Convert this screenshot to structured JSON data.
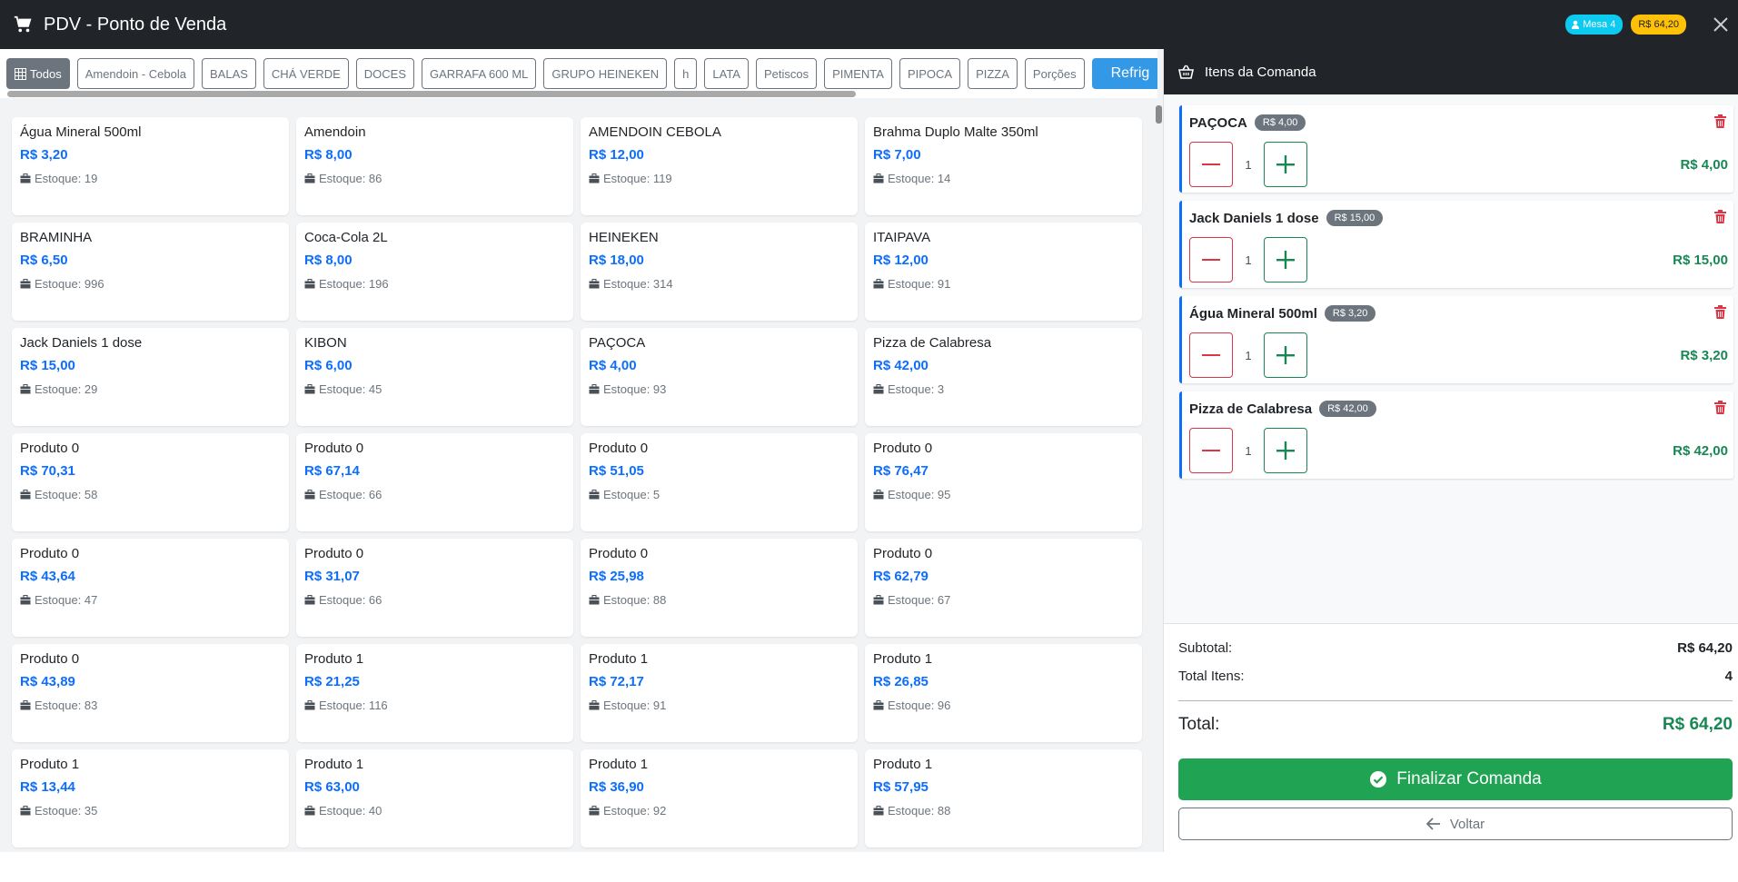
{
  "app": {
    "title": "PDV - Ponto de Venda",
    "mesa_badge": "Mesa 4",
    "total_badge": "R$ 64,20"
  },
  "categories": [
    {
      "label": "Todos",
      "active": true
    },
    {
      "label": "Amendoin - Cebola"
    },
    {
      "label": "BALAS"
    },
    {
      "label": "CHÁ VERDE"
    },
    {
      "label": "DOCES"
    },
    {
      "label": "GARRAFA 600 ML"
    },
    {
      "label": "GRUPO HEINEKEN"
    },
    {
      "label": "h"
    },
    {
      "label": "LATA"
    },
    {
      "label": "Petiscos"
    },
    {
      "label": "PIMENTA"
    },
    {
      "label": "PIPOCA"
    },
    {
      "label": "PIZZA"
    },
    {
      "label": "Porções"
    },
    {
      "label": "Refrig"
    }
  ],
  "products": [
    {
      "name": "Água Mineral 500ml",
      "price": "R$ 3,20",
      "stock": "Estoque: 19"
    },
    {
      "name": "Amendoin",
      "price": "R$ 8,00",
      "stock": "Estoque: 86"
    },
    {
      "name": "AMENDOIN CEBOLA",
      "price": "R$ 12,00",
      "stock": "Estoque: 119"
    },
    {
      "name": "Brahma Duplo Malte 350ml",
      "price": "R$ 7,00",
      "stock": "Estoque: 14"
    },
    {
      "name": "BRAMINHA",
      "price": "R$ 6,50",
      "stock": "Estoque: 996"
    },
    {
      "name": "Coca-Cola 2L",
      "price": "R$ 8,00",
      "stock": "Estoque: 196"
    },
    {
      "name": "HEINEKEN",
      "price": "R$ 18,00",
      "stock": "Estoque: 314"
    },
    {
      "name": "ITAIPAVA",
      "price": "R$ 12,00",
      "stock": "Estoque: 91"
    },
    {
      "name": "Jack Daniels 1 dose",
      "price": "R$ 15,00",
      "stock": "Estoque: 29"
    },
    {
      "name": "KIBON",
      "price": "R$ 6,00",
      "stock": "Estoque: 45"
    },
    {
      "name": "PAÇOCA",
      "price": "R$ 4,00",
      "stock": "Estoque: 93"
    },
    {
      "name": "Pizza de Calabresa",
      "price": "R$ 42,00",
      "stock": "Estoque: 3"
    },
    {
      "name": "Produto 0",
      "price": "R$ 70,31",
      "stock": "Estoque: 58"
    },
    {
      "name": "Produto 0",
      "price": "R$ 67,14",
      "stock": "Estoque: 66"
    },
    {
      "name": "Produto 0",
      "price": "R$ 51,05",
      "stock": "Estoque: 5"
    },
    {
      "name": "Produto 0",
      "price": "R$ 76,47",
      "stock": "Estoque: 95"
    },
    {
      "name": "Produto 0",
      "price": "R$ 43,64",
      "stock": "Estoque: 47"
    },
    {
      "name": "Produto 0",
      "price": "R$ 31,07",
      "stock": "Estoque: 66"
    },
    {
      "name": "Produto 0",
      "price": "R$ 25,98",
      "stock": "Estoque: 88"
    },
    {
      "name": "Produto 0",
      "price": "R$ 62,79",
      "stock": "Estoque: 67"
    },
    {
      "name": "Produto 0",
      "price": "R$ 43,89",
      "stock": "Estoque: 83"
    },
    {
      "name": "Produto 1",
      "price": "R$ 21,25",
      "stock": "Estoque: 116"
    },
    {
      "name": "Produto 1",
      "price": "R$ 72,17",
      "stock": "Estoque: 91"
    },
    {
      "name": "Produto 1",
      "price": "R$ 26,85",
      "stock": "Estoque: 96"
    },
    {
      "name": "Produto 1",
      "price": "R$ 13,44",
      "stock": "Estoque: 35"
    },
    {
      "name": "Produto 1",
      "price": "R$ 63,00",
      "stock": "Estoque: 40"
    },
    {
      "name": "Produto 1",
      "price": "R$ 36,90",
      "stock": "Estoque: 92"
    },
    {
      "name": "Produto 1",
      "price": "R$ 57,95",
      "stock": "Estoque: 88"
    }
  ],
  "order": {
    "header": "Itens da Comanda",
    "items": [
      {
        "name": "PAÇOCA",
        "unit_price": "R$ 4,00",
        "qty": "1",
        "line_total": "R$ 4,00"
      },
      {
        "name": "Jack Daniels 1 dose",
        "unit_price": "R$ 15,00",
        "qty": "1",
        "line_total": "R$ 15,00"
      },
      {
        "name": "Água Mineral 500ml",
        "unit_price": "R$ 3,20",
        "qty": "1",
        "line_total": "R$ 3,20"
      },
      {
        "name": "Pizza de Calabresa",
        "unit_price": "R$ 42,00",
        "qty": "1",
        "line_total": "R$ 42,00"
      }
    ],
    "subtotal_label": "Subtotal:",
    "subtotal_value": "R$ 64,20",
    "items_label": "Total Itens:",
    "items_value": "4",
    "total_label": "Total:",
    "total_value": "R$ 64,20",
    "finalize_label": "Finalizar Comanda",
    "back_label": "Voltar"
  },
  "colors": {
    "accent": "#0d6efd",
    "success": "#198754",
    "danger": "#dc3545",
    "dark": "#212529"
  }
}
